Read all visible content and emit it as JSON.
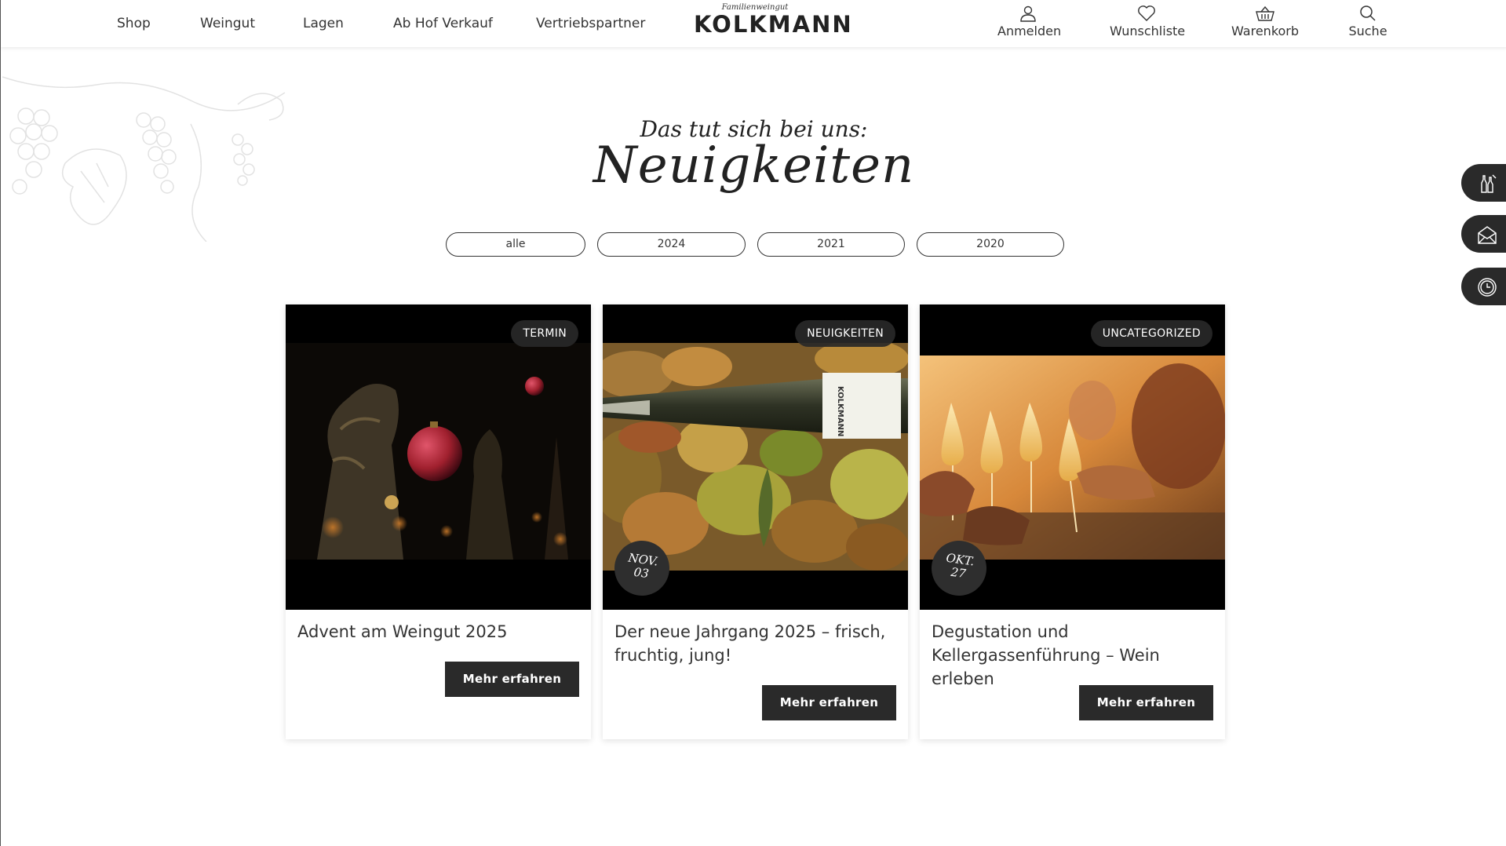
{
  "header": {
    "nav": [
      "Shop",
      "Weingut",
      "Lagen",
      "Ab Hof Verkauf",
      "Vertriebspartner"
    ],
    "logo_script": "Familienweingut",
    "logo_main": "KOLKMANN",
    "utilities": {
      "login": "Anmelden",
      "wishlist": "Wunschliste",
      "cart": "Warenkorb",
      "search": "Suche"
    }
  },
  "main": {
    "subtitle": "Das tut sich bei uns:",
    "title": "Neuigkeiten",
    "filters": [
      "alle",
      "2024",
      "2021",
      "2020"
    ]
  },
  "cards": [
    {
      "badge": "TERMIN",
      "date_month": "",
      "date_day": "",
      "title": "Advent am Weingut 2025",
      "button": "Mehr erfahren"
    },
    {
      "badge": "NEUIGKEITEN",
      "date_month": "NOV.",
      "date_day": "03",
      "title": "Der neue Jahrgang 2025 – frisch, fruchtig, jung!",
      "button": "Mehr erfahren",
      "bottle_label": "KOLKMANN"
    },
    {
      "badge": "UNCATEGORIZED",
      "date_month": "OKT.",
      "date_day": "27",
      "title": "Degustation und Kellergassenführung – Wein erleben",
      "button": "Mehr erfahren"
    }
  ],
  "icons": {
    "header": [
      "user-icon",
      "heart-icon",
      "basket-icon",
      "search-icon"
    ],
    "side_tabs": [
      "wine-bottles-icon",
      "newsletter-icon",
      "clock-icon"
    ]
  },
  "colors": {
    "dark": "#2a2a2a",
    "background": "#ffffff"
  }
}
